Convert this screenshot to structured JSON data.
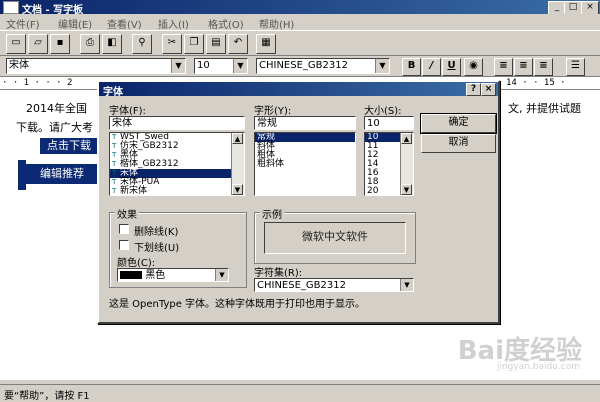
{
  "window": {
    "title": "文档 - 写字板"
  },
  "menu": [
    "文件(F)",
    "编辑(E)",
    "查看(V)",
    "插入(I)",
    "格式(O)",
    "帮助(H)"
  ],
  "toolbar": {
    "buttons": [
      "new-icon",
      "open-icon",
      "save-icon",
      "print-icon",
      "print-preview-icon",
      "find-icon",
      "cut-icon",
      "copy-icon",
      "paste-icon",
      "undo-icon",
      "datetime-icon"
    ]
  },
  "format": {
    "font": "宋体",
    "size": "10",
    "script": "CHINESE_GB2312",
    "bold": "B",
    "italic": "/",
    "underline": "U"
  },
  "ruler": {
    "left": "· · 1 · · · 2",
    "right": "14 · · 15 ·"
  },
  "document": {
    "line1_start": "2014年全国",
    "line1_end": "文, 并提供试题",
    "line2": "下载。请广大考",
    "button1": "点击下载",
    "button2": "编辑推荐"
  },
  "dialog": {
    "title": "字体",
    "help": "?",
    "close": "×",
    "font_label": "字体(F):",
    "font_value": "宋体",
    "fonts": [
      "WST_Swed",
      "仿宋_GB2312",
      "黑体",
      "楷体_GB2312",
      "宋体",
      "宋体-PUA",
      "新宋体"
    ],
    "selected_font_index": 4,
    "style_label": "字形(Y):",
    "style_value": "常规",
    "styles": [
      "常规",
      "斜体",
      "粗体",
      "粗斜体"
    ],
    "size_label": "大小(S):",
    "size_value": "10",
    "sizes": [
      "10",
      "11",
      "12",
      "14",
      "16",
      "18",
      "20"
    ],
    "ok": "确定",
    "cancel": "取消",
    "effects_label": "效果",
    "strikeout": "删除线(K)",
    "underline": "下划线(U)",
    "color_label": "颜色(C):",
    "color_value": "黑色",
    "sample_label": "示例",
    "sample_text": "微软中文软件",
    "charset_label": "字符集(R):",
    "charset_value": "CHINESE_GB2312",
    "note": "这是 OpenType 字体。这种字体既用于打印也用于显示。"
  },
  "statusbar": {
    "text": "要“帮助”，请按 F1"
  },
  "watermark": {
    "text": "Bai度经验",
    "sub": "jingyan.baidu.com"
  }
}
